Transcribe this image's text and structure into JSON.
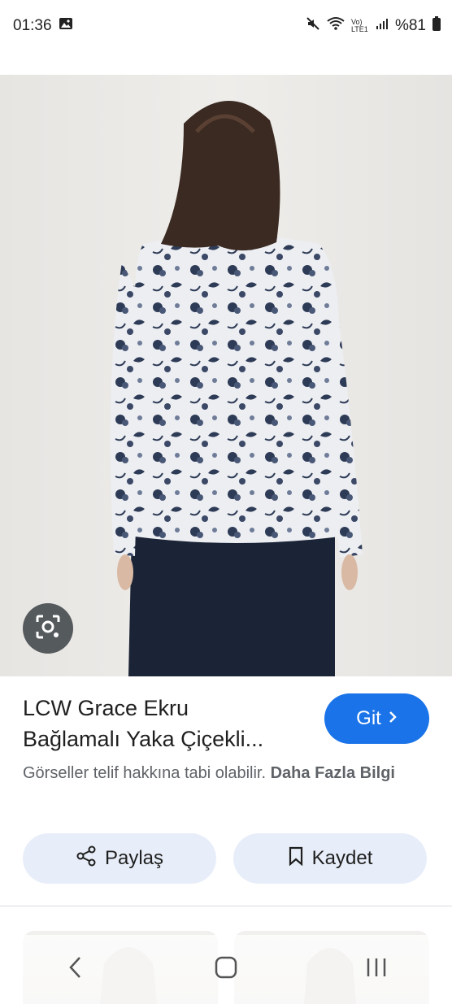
{
  "status": {
    "time": "01:36",
    "battery": "%81",
    "network": "Vo) LTE1"
  },
  "result": {
    "title": "LCW Grace Ekru\nBağlamalı Yaka Çiçekli...",
    "go_label": "Git",
    "copyright_text": "Görseller telif hakkına tabi olabilir.",
    "more_info": "Daha Fazla Bilgi"
  },
  "actions": {
    "share_label": "Paylaş",
    "save_label": "Kaydet"
  },
  "colors": {
    "primary": "#1a73e8",
    "pill_bg": "#e8eef9",
    "skirt": "#1b2336",
    "pattern_navy": "#2e3b56"
  },
  "icons": [
    "gallery-icon",
    "mute-icon",
    "wifi-icon",
    "signal-icon",
    "battery-icon",
    "lens-icon",
    "chevron-right-icon",
    "share-icon",
    "bookmark-icon",
    "back-icon",
    "home-icon",
    "recents-icon"
  ]
}
